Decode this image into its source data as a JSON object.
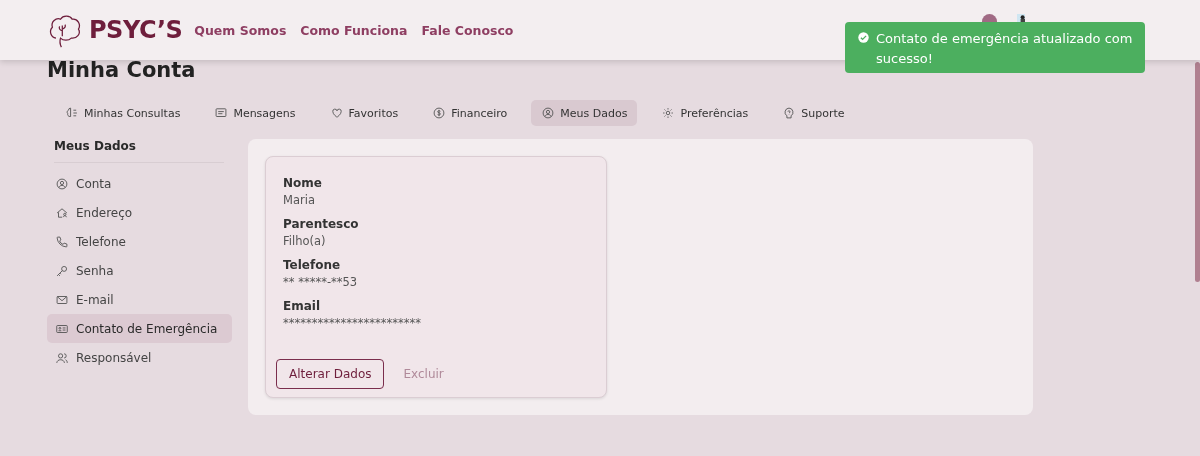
{
  "header": {
    "logo": "PSYC’S",
    "nav": [
      "Quem Somos",
      "Como Funciona",
      "Fale Conosco"
    ]
  },
  "toast": {
    "message": "Contato de emergência atualizado com sucesso!"
  },
  "page_title": "Minha Conta",
  "tabs": [
    {
      "label": "Minhas Consultas",
      "selected": false
    },
    {
      "label": "Mensagens",
      "selected": false
    },
    {
      "label": "Favoritos",
      "selected": false
    },
    {
      "label": "Financeiro",
      "selected": false
    },
    {
      "label": "Meus Dados",
      "selected": true
    },
    {
      "label": "Preferências",
      "selected": false
    },
    {
      "label": "Suporte",
      "selected": false
    }
  ],
  "sidebar": {
    "title": "Meus Dados",
    "items": [
      {
        "label": "Conta",
        "selected": false
      },
      {
        "label": "Endereço",
        "selected": false
      },
      {
        "label": "Telefone",
        "selected": false
      },
      {
        "label": "Senha",
        "selected": false
      },
      {
        "label": "E-mail",
        "selected": false
      },
      {
        "label": "Contato de Emergência",
        "selected": true
      },
      {
        "label": "Responsável",
        "selected": false
      }
    ]
  },
  "contact": {
    "fields": [
      {
        "label": "Nome",
        "value": "Maria"
      },
      {
        "label": "Parentesco",
        "value": "Filho(a)"
      },
      {
        "label": "Telefone",
        "value": "** *****-**53"
      },
      {
        "label": "Email",
        "value": "************************"
      }
    ],
    "buttons": [
      {
        "label": "Alterar Dados",
        "kind": "outline"
      },
      {
        "label": "Excluir",
        "kind": "text"
      }
    ]
  }
}
